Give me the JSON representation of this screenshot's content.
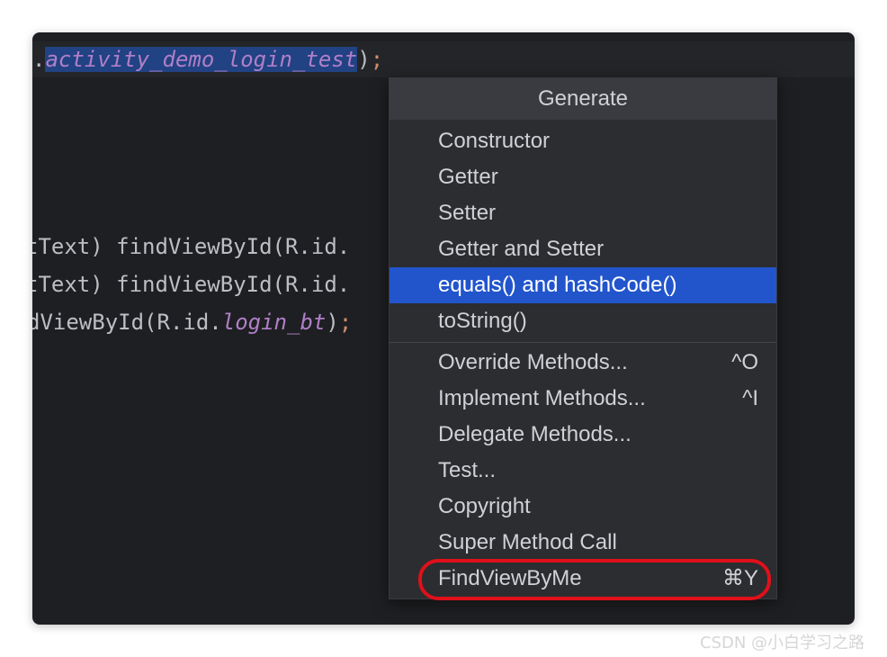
{
  "editor": {
    "line1": {
      "prefix": ".",
      "selected": "activity_demo_login_test",
      "close": ")",
      "semi": ";"
    },
    "line2": "tText) findViewById(R.id.",
    "line3": "tText) findViewById(R.id.",
    "line4": {
      "prefix": "dViewById(R.id.",
      "italic": "login_bt",
      "close": ")",
      "semi": ";"
    }
  },
  "popup": {
    "title": "Generate",
    "items": [
      {
        "label": "Constructor"
      },
      {
        "label": "Getter"
      },
      {
        "label": "Setter"
      },
      {
        "label": "Getter and Setter"
      },
      {
        "label": "equals() and hashCode()",
        "selected": true
      },
      {
        "label": "toString()"
      },
      {
        "label": "Override Methods...",
        "shortcut": "^O"
      },
      {
        "label": "Implement Methods...",
        "shortcut": "^I"
      },
      {
        "label": "Delegate Methods..."
      },
      {
        "label": "Test..."
      },
      {
        "label": "Copyright"
      },
      {
        "label": "Super Method Call"
      },
      {
        "label": "FindViewByMe",
        "shortcut": "⌘Y"
      }
    ]
  },
  "watermark": "CSDN @小白学习之路",
  "colors": {
    "selected_bg": "#2255cc",
    "highlight_ring": "#e0101a",
    "editor_bg": "#1e1f22",
    "popup_bg": "#2b2d30"
  }
}
